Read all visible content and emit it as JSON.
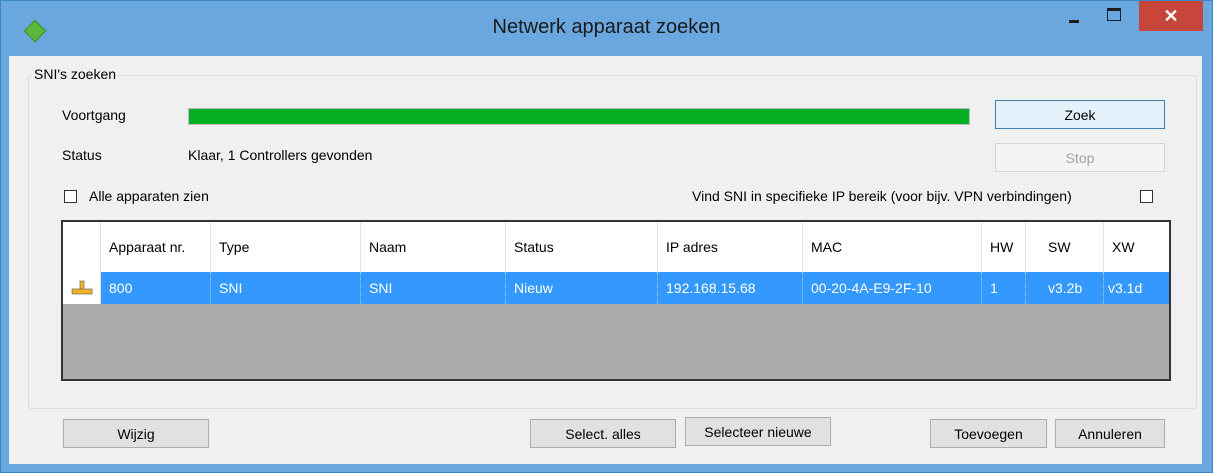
{
  "window": {
    "title": "Netwerk apparaat zoeken",
    "minimize": "–",
    "close": "✕"
  },
  "group": {
    "title": "SNI's zoeken"
  },
  "progress": {
    "label": "Voortgang",
    "value": 1.0
  },
  "status": {
    "label": "Status",
    "text": "Klaar, 1 Controllers gevonden"
  },
  "buttons": {
    "search": "Zoek",
    "stop": "Stop",
    "edit": "Wijzig",
    "select_all": "Select. alles",
    "select_new": "Selecteer nieuwe",
    "add": "Toevoegen",
    "cancel": "Annuleren"
  },
  "options": {
    "show_all": "Alle apparaten zien",
    "ip_range": "Vind SNI in specifieke IP bereik (voor bijv. VPN verbindingen)"
  },
  "table": {
    "columns": [
      "Apparaat nr.",
      "Type",
      "Naam",
      "Status",
      "IP adres",
      "MAC",
      "HW",
      "SW",
      "XW"
    ],
    "rows": [
      {
        "nr": "800",
        "type": "SNI",
        "name": "SNI",
        "status": "Nieuw",
        "ip": "192.168.15.68",
        "mac": "00-20-4A-E9-2F-10",
        "hw": "1",
        "sw": "v3.2b",
        "xw": "v3.1d",
        "icon": "row-arrow-icon"
      }
    ]
  },
  "colors": {
    "progress": "#06b025",
    "selection": "#3399ff",
    "titlebar": "#6aa7df",
    "close": "#c7463b"
  }
}
